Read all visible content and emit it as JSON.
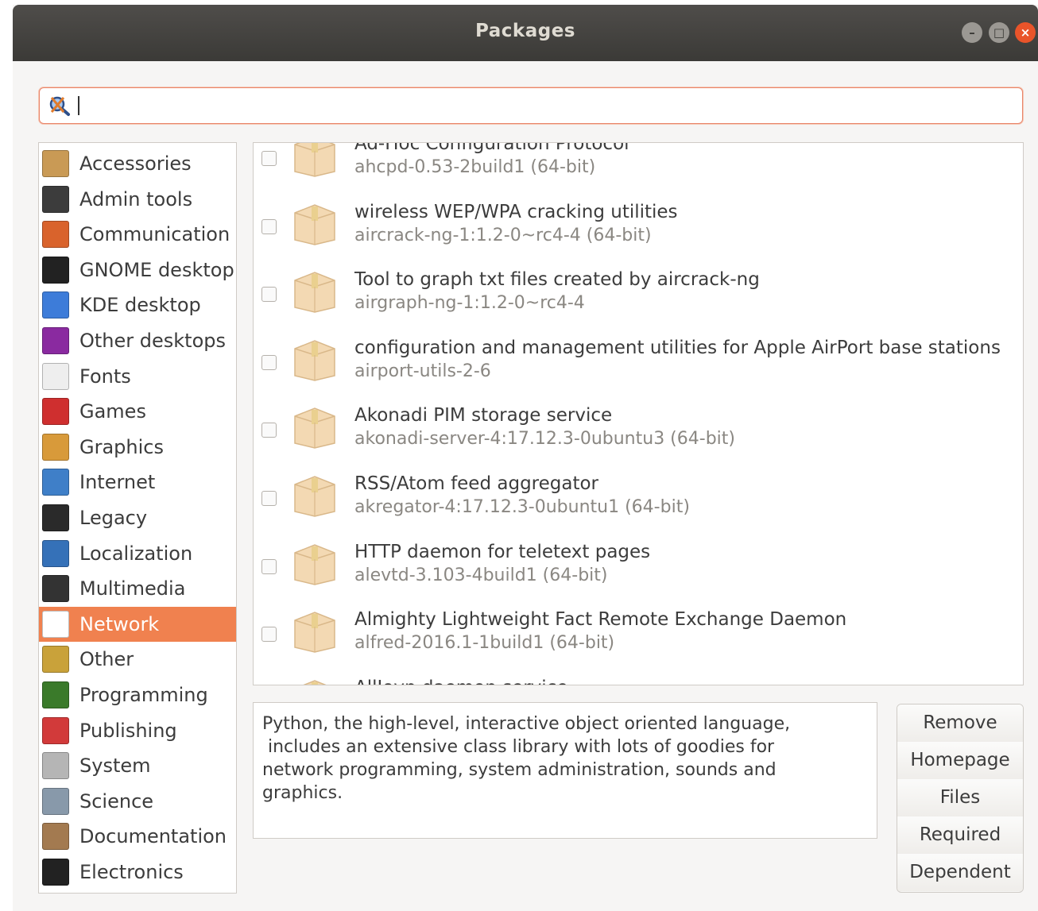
{
  "window": {
    "title": "Packages"
  },
  "search": {
    "value": ""
  },
  "sidebar": {
    "selected": "Network",
    "items": [
      {
        "label": "Accessories",
        "icon": "accessories-icon",
        "color": "#c99a55"
      },
      {
        "label": "Admin tools",
        "icon": "admin-tools-icon",
        "color": "#3c3c3c"
      },
      {
        "label": "Communication",
        "icon": "communication-icon",
        "color": "#d9632c"
      },
      {
        "label": "GNOME desktop",
        "icon": "gnome-foot-icon",
        "color": "#222222"
      },
      {
        "label": "KDE desktop",
        "icon": "kde-icon",
        "color": "#3d7cd9"
      },
      {
        "label": "Other desktops",
        "icon": "other-desktops-icon",
        "color": "#8a2aa0"
      },
      {
        "label": "Fonts",
        "icon": "fonts-icon",
        "color": "#eeeeee"
      },
      {
        "label": "Games",
        "icon": "games-cards-icon",
        "color": "#cf2f2f"
      },
      {
        "label": "Graphics",
        "icon": "graphics-icon",
        "color": "#d89a3a"
      },
      {
        "label": "Internet",
        "icon": "globe-icon",
        "color": "#3f7fc8"
      },
      {
        "label": "Legacy",
        "icon": "floppy-icon",
        "color": "#2a2a2a"
      },
      {
        "label": "Localization",
        "icon": "localization-icon",
        "color": "#3571b8"
      },
      {
        "label": "Multimedia",
        "icon": "multimedia-icon",
        "color": "#333333"
      },
      {
        "label": "Network",
        "icon": "network-icon",
        "color": "#ffffff"
      },
      {
        "label": "Other",
        "icon": "other-icon",
        "color": "#c9a23a"
      },
      {
        "label": "Programming",
        "icon": "programming-icon",
        "color": "#3a7a2a"
      },
      {
        "label": "Publishing",
        "icon": "publishing-icon",
        "color": "#d23a3a"
      },
      {
        "label": "System",
        "icon": "system-gear-icon",
        "color": "#b5b5b5"
      },
      {
        "label": "Science",
        "icon": "science-icon",
        "color": "#8899aa"
      },
      {
        "label": "Documentation",
        "icon": "documentation-icon",
        "color": "#a37a50"
      },
      {
        "label": "Electronics",
        "icon": "electronics-icon",
        "color": "#222222"
      }
    ]
  },
  "packages": [
    {
      "name": "Ad-Hoc Configuration Protocol",
      "version": "ahcpd-0.53-2build1 (64-bit)"
    },
    {
      "name": "wireless WEP/WPA cracking utilities",
      "version": "aircrack-ng-1:1.2-0~rc4-4 (64-bit)"
    },
    {
      "name": "Tool to graph txt files created by aircrack-ng",
      "version": "airgraph-ng-1:1.2-0~rc4-4"
    },
    {
      "name": "configuration and management utilities for Apple AirPort base stations",
      "version": "airport-utils-2-6"
    },
    {
      "name": "Akonadi PIM storage service",
      "version": "akonadi-server-4:17.12.3-0ubuntu3 (64-bit)"
    },
    {
      "name": "RSS/Atom feed aggregator",
      "version": "akregator-4:17.12.3-0ubuntu1 (64-bit)"
    },
    {
      "name": "HTTP daemon for teletext pages",
      "version": "alevtd-3.103-4build1 (64-bit)"
    },
    {
      "name": "Almighty Lightweight Fact Remote Exchange Daemon",
      "version": "alfred-2016.1-1build1 (64-bit)"
    },
    {
      "name": "AllJoyn daemon service",
      "version": ""
    }
  ],
  "description": {
    "text": "Python, the high-level, interactive object oriented language,\n includes an extensive class library with lots of goodies for\nnetwork programming, system administration, sounds and\ngraphics."
  },
  "actions": {
    "remove": "Remove",
    "homepage": "Homepage",
    "files": "Files",
    "required": "Required",
    "dependent": "Dependent"
  },
  "colors": {
    "accent": "#f0814f",
    "titlebar": "#3b3a37",
    "close": "#e9542a"
  }
}
